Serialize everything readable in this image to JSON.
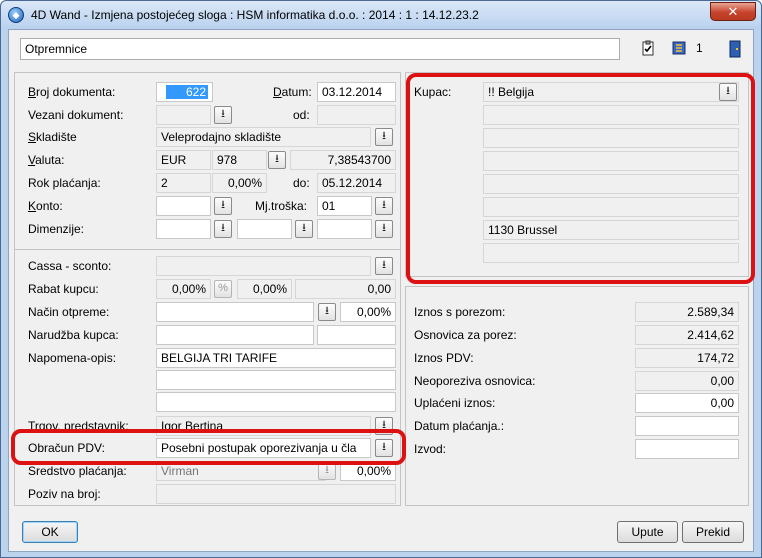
{
  "window": {
    "title": "4D Wand - Izmjena postojećeg sloga : HSM informatika d.o.o. : 2014 : 1 : 14.12.23.2",
    "close_label": "✕"
  },
  "toolbar": {
    "form_title": "Otpremnice",
    "record_number": "1"
  },
  "left": {
    "broj_dokumenta": {
      "label_u": "B",
      "label_rest": "roj dokumenta:",
      "value": "622"
    },
    "datum": {
      "label_u": "D",
      "label_rest": "atum:",
      "value": "03.12.2014"
    },
    "vezani_dokument": {
      "label": "Vezani dokument:",
      "value": ""
    },
    "od": {
      "label": "od:",
      "value": ""
    },
    "skladiste": {
      "label_u": "S",
      "label_rest": "kladište",
      "value": "Veleprodajno skladište"
    },
    "valuta": {
      "label_u": "V",
      "label_rest": "aluta:",
      "code": "EUR",
      "number": "978",
      "rate": "7,38543700"
    },
    "rok_placanja": {
      "label": "Rok plaćanja:",
      "days": "2",
      "percent": "0,00%",
      "do_label": "do:",
      "do_value": "05.12.2014"
    },
    "konto": {
      "label_u": "K",
      "label_rest": "onto:",
      "value": ""
    },
    "mj_troska": {
      "label": "Mj.troška:",
      "value": "01"
    },
    "dimenzije": {
      "label": "Dimenzije:"
    },
    "cassa_sconto": {
      "label": "Cassa - sconto:"
    },
    "rabat_kupcu": {
      "label": "Rabat kupcu:",
      "v1": "0,00%",
      "v2": "0,00%",
      "v3": "0,00"
    },
    "nacin_otpreme": {
      "label": "Način otpreme:",
      "percent": "0,00%"
    },
    "narudzba_kupca": {
      "label": "Narudžba kupca:"
    },
    "napomena_opis": {
      "label": "Napomena-opis:",
      "value": "BELGIJA TRI TARIFE"
    },
    "trgov_predstavnik": {
      "label": "Trgov. predstavnik:",
      "value": "Igor Bertina"
    },
    "obracun_pdv": {
      "label": "Obračun PDV:",
      "value": "Posebni postupak oporezivanja u čla"
    },
    "sredstvo_placanja": {
      "label": "Sredstvo plaćanja:",
      "value": "Virman",
      "percent": "0,00%"
    },
    "poziv_na_broj": {
      "label": "Poziv na broj:"
    }
  },
  "right": {
    "kupac": {
      "label": "Kupac:",
      "name": "!! Belgija",
      "city": "1130 Brussel"
    },
    "iznos_s_porezom": {
      "label": "Iznos s porezom:",
      "value": "2.589,34"
    },
    "osnovica_za_porez": {
      "label": "Osnovica za porez:",
      "value": "2.414,62"
    },
    "iznos_pdv": {
      "label": "Iznos PDV:",
      "value": "174,72"
    },
    "neoporeziva_osnovica": {
      "label": "Neoporeziva osnovica:",
      "value": "0,00"
    },
    "uplaceni_iznos": {
      "label": "Uplaćeni iznos:",
      "value": "0,00"
    },
    "datum_placanja": {
      "label": "Datum plaćanja.:"
    },
    "izvod": {
      "label": "Izvod:"
    }
  },
  "buttons": {
    "ok": "OK",
    "upute": "Upute",
    "prekid": "Prekid"
  },
  "colors": {
    "highlight": "#dd1111",
    "selection": "#3399ff",
    "title_bar": "#b9d1ee"
  }
}
